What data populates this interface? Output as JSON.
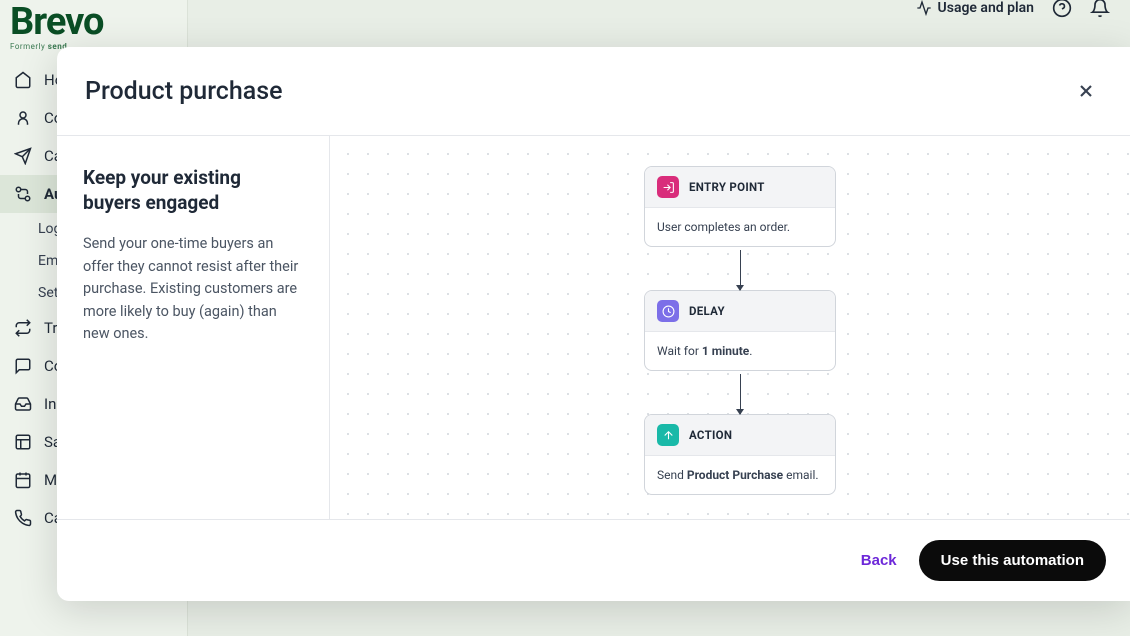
{
  "topbar": {
    "usage": "Usage and plan"
  },
  "logo": {
    "text": "Brevo",
    "sub_prefix": "Formerly ",
    "sub_brand": "send"
  },
  "sidebar": {
    "items": [
      {
        "label": "Home"
      },
      {
        "label": "Contacts"
      },
      {
        "label": "Campaigns"
      },
      {
        "label": "Automations"
      },
      {
        "label": "Transactional"
      },
      {
        "label": "Conversations"
      },
      {
        "label": "Inbox"
      },
      {
        "label": "Sales CRM"
      },
      {
        "label": "Meetings"
      },
      {
        "label": "Calls"
      }
    ],
    "sub": [
      {
        "label": "Logs"
      },
      {
        "label": "Email templates"
      },
      {
        "label": "Settings"
      }
    ]
  },
  "modal": {
    "title": "Product purchase",
    "left": {
      "heading": "Keep your existing buyers engaged",
      "desc": "Send your one-time buyers an offer they cannot resist after their purchase. Existing customers are more likely to buy (again) than new ones."
    },
    "flow": {
      "entry": {
        "title": "ENTRY POINT",
        "body": "User completes an order."
      },
      "delay": {
        "title": "DELAY",
        "body_prefix": "Wait for ",
        "body_bold": "1 minute",
        "body_suffix": "."
      },
      "action": {
        "title": "ACTION",
        "body_prefix": "Send ",
        "body_bold": "Product Purchase",
        "body_suffix": " email."
      }
    },
    "footer": {
      "back": "Back",
      "primary": "Use this automation"
    }
  }
}
